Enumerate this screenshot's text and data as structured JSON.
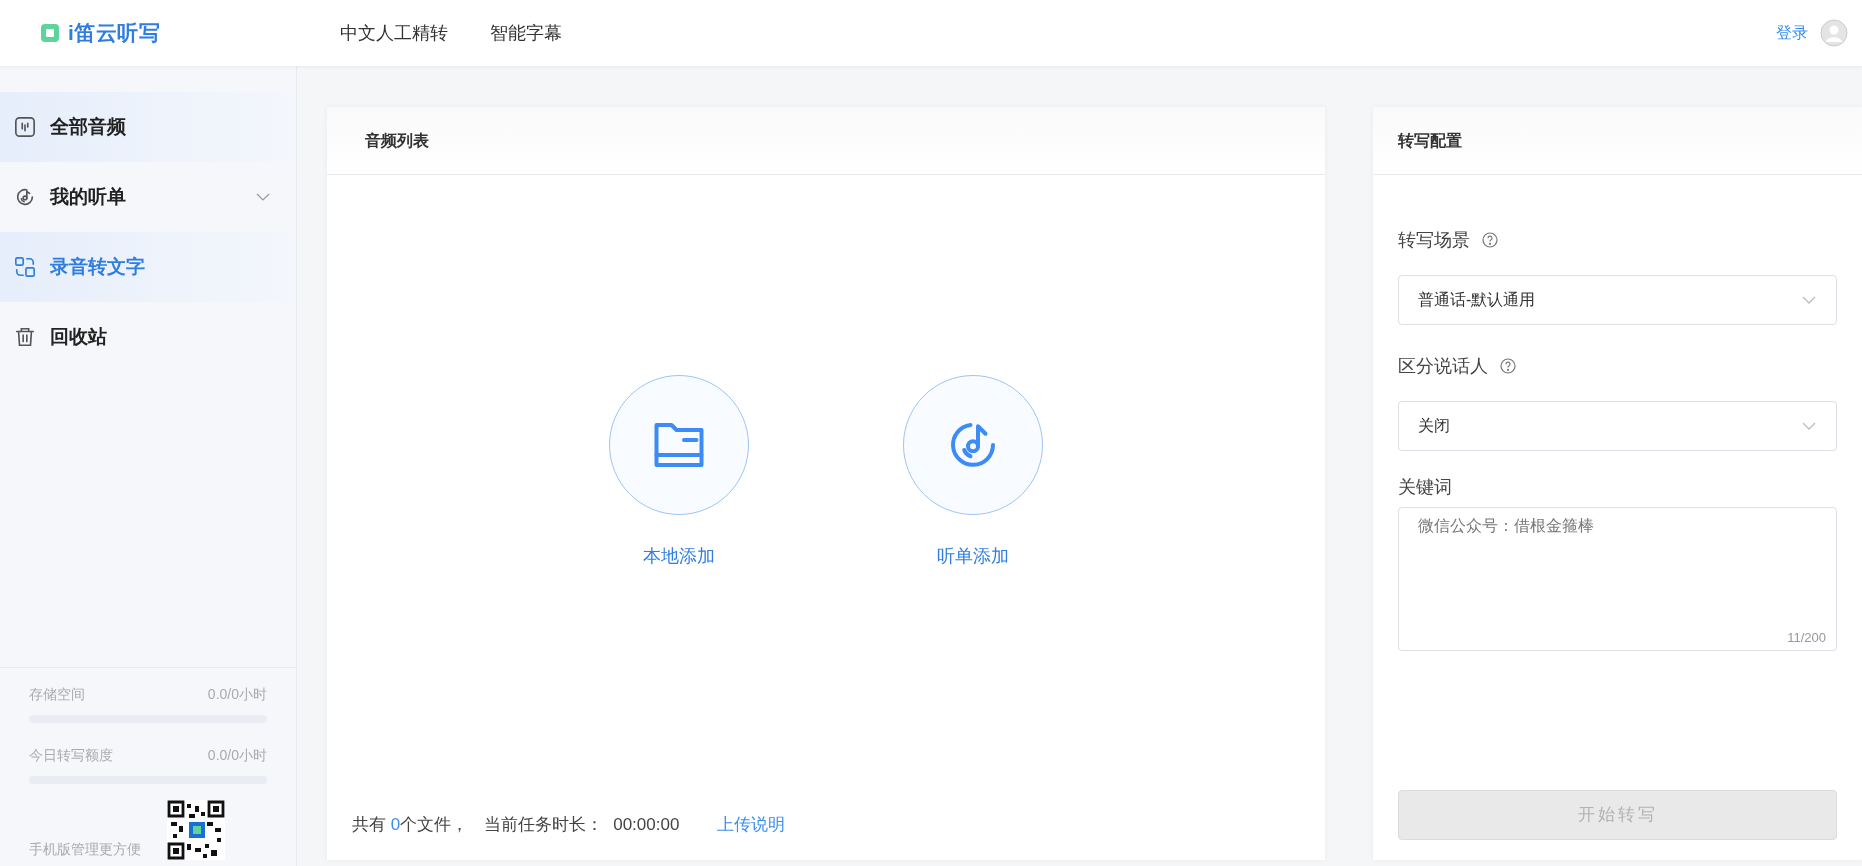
{
  "header": {
    "logo": "i笛云听写",
    "nav": [
      {
        "label": "中文人工精转",
        "selected": false
      },
      {
        "label": "智能字幕",
        "selected": false
      }
    ],
    "login": "登录"
  },
  "sidebar": {
    "items": [
      {
        "kind": "audio",
        "label": "全部音频",
        "selected": false,
        "hovered": true,
        "expandable": false
      },
      {
        "kind": "disc",
        "label": "我的听单",
        "selected": false,
        "hovered": false,
        "expandable": true,
        "expanded": false
      },
      {
        "kind": "convert",
        "label": "录音转文字",
        "selected": true,
        "hovered": false,
        "expandable": false
      },
      {
        "kind": "trash",
        "label": "回收站",
        "selected": false,
        "hovered": false,
        "expandable": false
      }
    ],
    "quotas": [
      {
        "label": "存储空间",
        "reading": "0.0/0小时",
        "level": 0
      },
      {
        "label": "今日转写额度",
        "reading": "0.0/0小时",
        "level": 0
      }
    ],
    "mobile_hint": "手机版管理更方便"
  },
  "audio_list": {
    "title": "音频列表",
    "actions": [
      {
        "kind": "folder",
        "label": "本地添加"
      },
      {
        "kind": "disc",
        "label": "听单添加"
      }
    ],
    "footer": {
      "prefix": "共有 ",
      "count": "0",
      "suffix": "个文件，",
      "duration_label": "当前任务时长：",
      "duration": "00:00:00",
      "link": "上传说明"
    }
  },
  "config": {
    "title": "转写配置",
    "fields": [
      {
        "kind": "select",
        "label": "转写场景",
        "help": true,
        "value": "普通话-默认通用"
      },
      {
        "kind": "select",
        "label": "区分说话人",
        "help": true,
        "value": "关闭"
      },
      {
        "kind": "textarea",
        "label": "关键词",
        "help": false,
        "value": "微信公众号：借根金箍棒",
        "counter": "11/200"
      }
    ],
    "start_button": {
      "label": "开始转写",
      "disabled": true
    }
  }
}
